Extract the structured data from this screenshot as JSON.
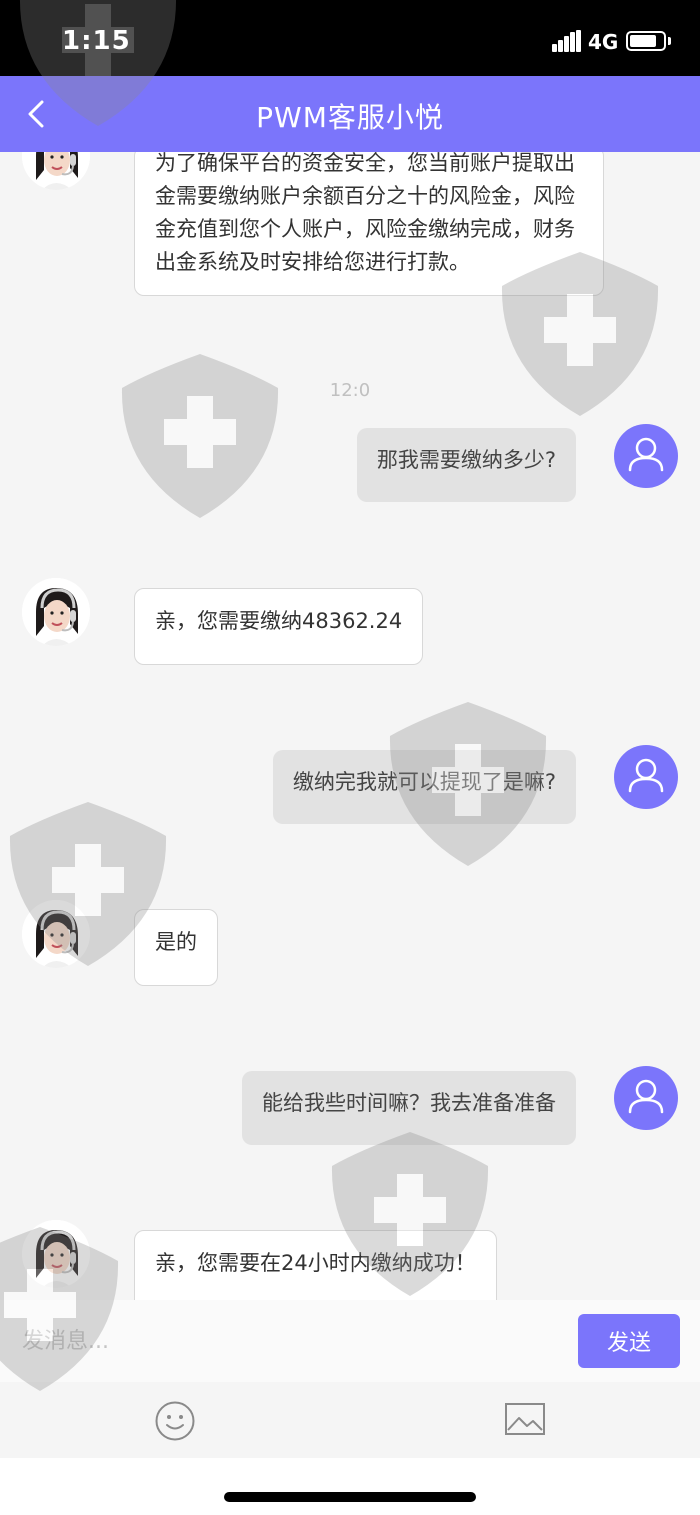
{
  "status_bar": {
    "time": "1:15",
    "network": "4G",
    "signal_icon": "signal-bars-icon",
    "battery_icon": "battery-icon",
    "battery_level": 0.8
  },
  "header": {
    "title": "PWM客服小悦",
    "back_icon": "chevron-left-icon"
  },
  "colors": {
    "accent": "#7b75fb",
    "status_bar": "#000000",
    "background": "#f5f5f5",
    "agent_bubble": "#ffffff",
    "user_bubble": "#e2e2e2",
    "timestamp": "#c0c0c0"
  },
  "chat": {
    "timestamp": "12:0",
    "messages": [
      {
        "sender": "agent",
        "text": "为了确保平台的资金安全，您当前账户提取出金需要缴纳账户余额百分之十的风险金，风险金充值到您个人账户，风险金缴纳完成，财务出金系统及时安排给您进行打款。"
      },
      {
        "sender": "user",
        "text": "那我需要缴纳多少?"
      },
      {
        "sender": "agent",
        "text": "亲，您需要缴纳48362.24"
      },
      {
        "sender": "user",
        "text": "缴纳完我就可以提现了是嘛?"
      },
      {
        "sender": "agent",
        "text": "是的"
      },
      {
        "sender": "user",
        "text": "能给我些时间嘛？我去准备准备"
      },
      {
        "sender": "agent",
        "text": "亲，您需要在24小时内缴纳成功！"
      }
    ]
  },
  "input": {
    "placeholder": "发消息...",
    "value": "",
    "send_label": "发送"
  },
  "toolbar": {
    "emoji_icon": "emoji-icon",
    "image_icon": "image-icon"
  }
}
